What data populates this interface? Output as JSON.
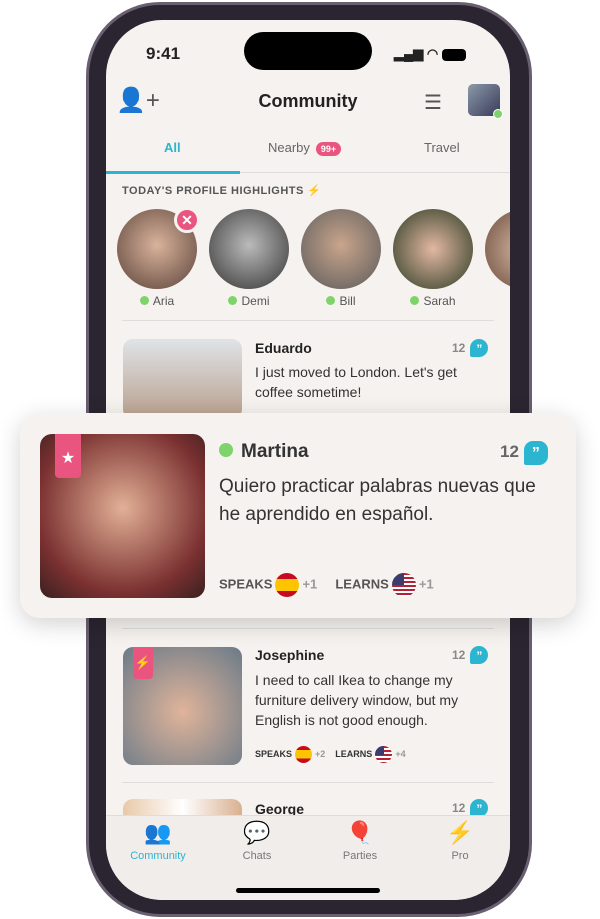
{
  "status": {
    "time": "9:41"
  },
  "header": {
    "title": "Community",
    "add_user_icon": "user-plus-icon",
    "filter_icon": "sliders-icon"
  },
  "tabs": [
    {
      "label": "All",
      "active": true
    },
    {
      "label": "Nearby",
      "badge": "99+"
    },
    {
      "label": "Travel"
    }
  ],
  "highlights": {
    "title": "TODAY'S PROFILE HIGHLIGHTS",
    "icon": "lightning-icon",
    "people": [
      {
        "name": "Aria"
      },
      {
        "name": "Demi"
      },
      {
        "name": "Bill"
      },
      {
        "name": "Sarah"
      }
    ]
  },
  "posts": [
    {
      "name": "Eduardo",
      "count": "12",
      "message": "I just moved to London. Let's get coffee sometime!"
    },
    {
      "name": "Martina",
      "count": "12",
      "message": "Quiero practicar palabras nuevas que he aprendido en español.",
      "speaks_label": "SPEAKS",
      "speaks_extra": "+1",
      "learns_label": "LEARNS",
      "learns_extra": "+1"
    },
    {
      "name": "Josephine",
      "count": "12",
      "message": "I need to call Ikea to change my furniture delivery window, but my English is not good enough.",
      "speaks_label": "SPEAKS",
      "speaks_extra": "+2",
      "learns_label": "LEARNS",
      "learns_extra": "+4"
    },
    {
      "name": "George",
      "count": "12"
    }
  ],
  "nav": [
    {
      "label": "Community",
      "active": true
    },
    {
      "label": "Chats"
    },
    {
      "label": "Parties"
    },
    {
      "label": "Pro"
    }
  ],
  "colors": {
    "accent": "#2cb5d0",
    "pink": "#e9557f",
    "online": "#7ed36a"
  }
}
